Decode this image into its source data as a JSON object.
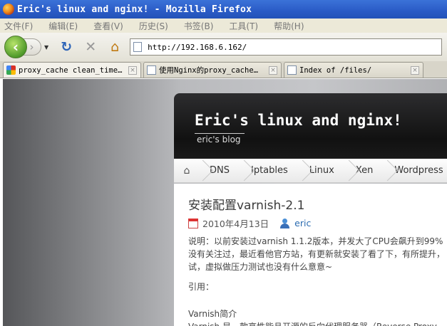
{
  "window": {
    "title": "Eric's linux and nginx! - Mozilla Firefox"
  },
  "menu": [
    "文件(F)",
    "编辑(E)",
    "查看(V)",
    "历史(S)",
    "书签(B)",
    "工具(T)",
    "帮助(H)"
  ],
  "toolbar": {
    "back_icon": "‹",
    "forward_icon": "›",
    "reload_icon": "↻",
    "stop_icon": "✕",
    "home_icon": "⌂",
    "url": "http://192.168.6.162/"
  },
  "tabs": [
    {
      "label": "proxy_cache clean_time…",
      "favicon": "google"
    },
    {
      "label": "使用Nginx的proxy_cache…",
      "favicon": "doc"
    },
    {
      "label": "Index of /files/",
      "favicon": "doc"
    }
  ],
  "blog": {
    "title": "Eric's linux and nginx!",
    "subtitle": "eric's blog",
    "nav": [
      "DNS",
      "Iptables",
      "Linux",
      "Xen",
      "Wordpress"
    ]
  },
  "post": {
    "title": "安装配置varnish-2.1",
    "date": "2010年4月13日",
    "author": "eric",
    "body": [
      "说明：以前安装过varnish 1.1.2版本，并发大了CPU会飙升到99%",
      "没有关注过，最近看他官方站，有更新就安装了看了下，有所提升，",
      "试，虚拟做压力测试也没有什么意意~"
    ],
    "quote_label": "引用：",
    "section_title": "Varnish简介",
    "section_text": "Varnish 是一款高性能且开源的反向代理服务器（Reverse Proxy"
  },
  "colors": {
    "titlebar": "#2a5bc6",
    "header_bg": "#111111",
    "link": "#2b6cb0"
  }
}
